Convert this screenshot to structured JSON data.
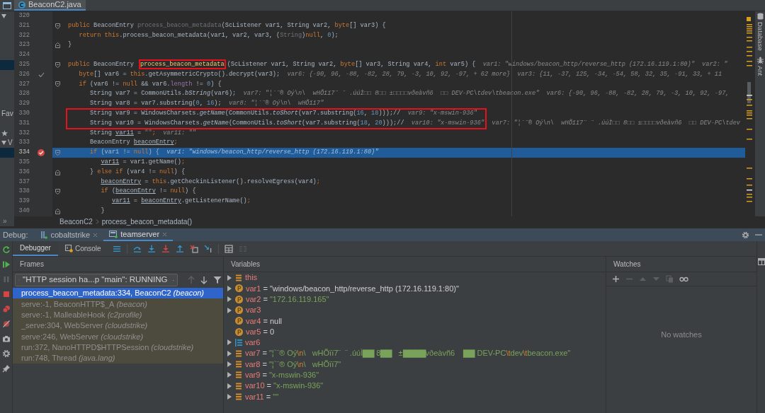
{
  "editor_tabs": [
    {
      "label": "BeaconC2.java",
      "selected": true
    }
  ],
  "project_panel": {
    "rows": [
      {
        "kind": "arrow",
        "selected": false
      },
      {
        "kind": "blank",
        "selected": false
      },
      {
        "kind": "blank",
        "selected": false
      },
      {
        "kind": "blank",
        "selected": false
      },
      {
        "kind": "blank",
        "selected": false
      },
      {
        "kind": "blank",
        "selected": true
      },
      {
        "kind": "blank",
        "selected": false
      },
      {
        "kind": "blank",
        "selected": false
      },
      {
        "kind": "blank",
        "selected": false
      },
      {
        "kind": "blank",
        "selected": false
      },
      {
        "kind": "label",
        "text": "Fav",
        "selected": false
      },
      {
        "kind": "blank",
        "selected": false
      },
      {
        "kind": "star",
        "selected": false
      },
      {
        "kind": "arrow-label",
        "text": "V",
        "selected": false
      },
      {
        "kind": "blank",
        "selected": true
      },
      {
        "kind": "blank",
        "selected": false
      },
      {
        "kind": "blank",
        "selected": false
      },
      {
        "kind": "blank",
        "selected": false
      },
      {
        "kind": "blank",
        "selected": false
      },
      {
        "kind": "blank",
        "selected": false
      },
      {
        "kind": "blank",
        "selected": false
      }
    ],
    "collapse_label": "»"
  },
  "editor": {
    "lines": [
      {
        "number": "320",
        "current": false,
        "breakpoint": false,
        "checked": false,
        "fold_start": false,
        "fold_end": false
      },
      {
        "number": "321",
        "current": false,
        "breakpoint": false,
        "checked": false,
        "fold_start": true,
        "fold_end": false,
        "code": [
          {
            "kind": "keyword",
            "text": "public"
          },
          {
            "kind": "plain",
            "text": " BeaconEntry "
          },
          {
            "kind": "unused",
            "text": "process_beacon_metadata"
          },
          {
            "kind": "plain",
            "text": "(ScListener var1, String var2, "
          },
          {
            "kind": "keyword",
            "text": "byte"
          },
          {
            "kind": "plain",
            "text": "[] var3) {"
          }
        ]
      },
      {
        "number": "322",
        "current": false,
        "breakpoint": false,
        "checked": false,
        "fold_start": false,
        "fold_end": false,
        "code": [
          {
            "kind": "keyword",
            "text": "   return this"
          },
          {
            "kind": "plain",
            "text": ".process_beacon_metadata(var1, var2, var3, ("
          },
          {
            "kind": "unused",
            "text": "String"
          },
          {
            "kind": "plain",
            "text": ")"
          },
          {
            "kind": "keyword",
            "text": "null"
          },
          {
            "kind": "plain",
            "text": ", "
          },
          {
            "kind": "number",
            "text": "0"
          },
          {
            "kind": "plain",
            "text": ");"
          }
        ]
      },
      {
        "number": "323",
        "current": false,
        "breakpoint": false,
        "checked": false,
        "fold_start": false,
        "fold_end": true,
        "code": [
          {
            "kind": "plain",
            "text": "}"
          }
        ]
      },
      {
        "number": "324",
        "current": false,
        "breakpoint": false,
        "checked": false,
        "fold_start": false,
        "fold_end": false
      },
      {
        "number": "325",
        "current": false,
        "breakpoint": false,
        "checked": false,
        "fold_start": true,
        "fold_end": false,
        "code": [
          {
            "kind": "keyword",
            "text": "public"
          },
          {
            "kind": "plain",
            "text": " BeaconEntry "
          },
          {
            "kind": "declaration",
            "text": "process_beacon_metadata",
            "boxed": true
          },
          {
            "kind": "plain",
            "text": "(ScListener var1, String var2, "
          },
          {
            "kind": "keyword",
            "text": "byte"
          },
          {
            "kind": "plain",
            "text": "[] var3, String var4, "
          },
          {
            "kind": "keyword",
            "text": "int"
          },
          {
            "kind": "plain",
            "text": " var5) {"
          },
          {
            "kind": "hint",
            "text": "  var1: \"windows/beacon_http/reverse_http (172.16.119.1:80)\"  var2: \""
          }
        ]
      },
      {
        "number": "326",
        "current": false,
        "breakpoint": false,
        "checked": true,
        "fold_start": false,
        "fold_end": false,
        "code": [
          {
            "kind": "keyword",
            "text": "   byte"
          },
          {
            "kind": "plain",
            "text": "[] var6 = "
          },
          {
            "kind": "keyword",
            "text": "this"
          },
          {
            "kind": "plain",
            "text": ".getAsymmetricCrypto().decrypt(var3);"
          },
          {
            "kind": "hint",
            "text": "  var6: {-90, 96, -88, -82, 28, 79, -3, 10, 92, -97, + 62 more}  var3: {11, -37, 125, -34, -54, 58, 32, 35, -91, 33, + 11"
          }
        ]
      },
      {
        "number": "327",
        "current": false,
        "breakpoint": false,
        "checked": false,
        "fold_start": true,
        "fold_end": false,
        "code": [
          {
            "kind": "keyword",
            "text": "   if"
          },
          {
            "kind": "plain",
            "text": " (var6 != "
          },
          {
            "kind": "keyword",
            "text": "null"
          },
          {
            "kind": "plain",
            "text": " && var6."
          },
          {
            "kind": "field",
            "text": "length"
          },
          {
            "kind": "plain",
            "text": " != "
          },
          {
            "kind": "number",
            "text": "0"
          },
          {
            "kind": "plain",
            "text": ") {"
          }
        ]
      },
      {
        "number": "328",
        "current": false,
        "breakpoint": false,
        "checked": false,
        "fold_start": false,
        "fold_end": false,
        "code": [
          {
            "kind": "plain",
            "text": "      String var7 = CommonUtils."
          },
          {
            "kind": "static_call",
            "text": "bString"
          },
          {
            "kind": "plain",
            "text": "(var6);"
          },
          {
            "kind": "hint",
            "text": "  var7: \"¦`¨® Oý\\n\\  wHÕïï7¨ ¨ .úúÌ□□ 8□□ ±□□□□vðeàvñ6  □□ DEV-PC\\tdev\\tbeacon.exe\"  var6: {-90, 96, -88, -82, 28, 79, -3, 10, 92, -97,"
          }
        ]
      },
      {
        "number": "329",
        "current": false,
        "breakpoint": false,
        "checked": false,
        "fold_start": false,
        "fold_end": false,
        "code": [
          {
            "kind": "plain",
            "text": "      String var8 = var7.substring("
          },
          {
            "kind": "number",
            "text": "0"
          },
          {
            "kind": "plain",
            "text": ", "
          },
          {
            "kind": "number",
            "text": "16"
          },
          {
            "kind": "plain",
            "text": ");"
          },
          {
            "kind": "hint",
            "text": "  var8: \"¦`¨® Oý\\n\\  wHÕïï7\""
          }
        ]
      },
      {
        "number": "330",
        "current": false,
        "breakpoint": false,
        "checked": false,
        "fold_start": false,
        "fold_end": false,
        "code": [
          {
            "kind": "plain",
            "text": "      String var9 = WindowsCharsets.",
            "boxed": true
          },
          {
            "kind": "static_call",
            "text": "getName",
            "boxed": true
          },
          {
            "kind": "plain",
            "text": "(CommonUtils.",
            "boxed": true
          },
          {
            "kind": "static_call",
            "text": "toShort",
            "boxed": true
          },
          {
            "kind": "plain",
            "text": "(var7.substring(",
            "boxed": true
          },
          {
            "kind": "number",
            "text": "16",
            "boxed": true
          },
          {
            "kind": "plain",
            "text": ", ",
            "boxed": true
          },
          {
            "kind": "number",
            "text": "18",
            "boxed": true
          },
          {
            "kind": "plain",
            "text": ")));//",
            "boxed": true
          },
          {
            "kind": "hint",
            "text": "  var9: \"x-mswin-936\"",
            "boxed": true
          }
        ]
      },
      {
        "number": "331",
        "current": false,
        "breakpoint": false,
        "checked": false,
        "fold_start": false,
        "fold_end": false,
        "code": [
          {
            "kind": "plain",
            "text": "      String var10 = WindowsCharsets.",
            "boxed": true
          },
          {
            "kind": "static_call",
            "text": "getName",
            "boxed": true
          },
          {
            "kind": "plain",
            "text": "(CommonUtils.",
            "boxed": true
          },
          {
            "kind": "static_call",
            "text": "toShort",
            "boxed": true
          },
          {
            "kind": "plain",
            "text": "(var7.substring(",
            "boxed": true
          },
          {
            "kind": "number",
            "text": "18",
            "boxed": true
          },
          {
            "kind": "plain",
            "text": ", ",
            "boxed": true
          },
          {
            "kind": "number",
            "text": "20",
            "boxed": true
          },
          {
            "kind": "plain",
            "text": ")));//",
            "boxed": true
          },
          {
            "kind": "hint",
            "text": "  var10: \"x-mswin-936\"",
            "boxed": true
          },
          {
            "kind": "hint",
            "text": "  var7: \"¦`¨® Oý\\n\\  wHÕïï7¨ ¨ .úúÌ□□ 8□□ ±□□□□vðeàvñ6  □□ DEV-PC\\tdev"
          }
        ]
      },
      {
        "number": "332",
        "current": false,
        "breakpoint": false,
        "checked": false,
        "fold_start": false,
        "fold_end": false,
        "code": [
          {
            "kind": "plain",
            "text": "      String "
          },
          {
            "kind": "local",
            "text": "var11"
          },
          {
            "kind": "plain",
            "text": " = "
          },
          {
            "kind": "string",
            "text": "\"\""
          },
          {
            "kind": "keyword",
            "text": ";"
          },
          {
            "kind": "hint",
            "text": "  var11: \"\""
          }
        ]
      },
      {
        "number": "333",
        "current": false,
        "breakpoint": false,
        "checked": false,
        "fold_start": false,
        "fold_end": false,
        "code": [
          {
            "kind": "plain",
            "text": "      BeaconEntry "
          },
          {
            "kind": "local",
            "text": "beaconEntry"
          },
          {
            "kind": "keyword",
            "text": ";"
          }
        ]
      },
      {
        "number": "334",
        "current": true,
        "breakpoint": true,
        "checked": false,
        "fold_start": true,
        "fold_end": false,
        "code": [
          {
            "kind": "keyword",
            "text": "      if"
          },
          {
            "kind": "plain",
            "text": " (var1 != "
          },
          {
            "kind": "keyword",
            "text": "null"
          },
          {
            "kind": "plain",
            "text": ") {"
          },
          {
            "kind": "hint",
            "text": "  var1: \"windows/beacon_http/reverse_http (172.16.119.1:80)\""
          }
        ]
      },
      {
        "number": "335",
        "current": false,
        "breakpoint": false,
        "checked": false,
        "fold_start": false,
        "fold_end": false,
        "code": [
          {
            "kind": "local",
            "text": "         var11"
          },
          {
            "kind": "plain",
            "text": " = var1.getName()"
          },
          {
            "kind": "keyword",
            "text": ";"
          }
        ]
      },
      {
        "number": "336",
        "current": false,
        "breakpoint": false,
        "checked": false,
        "fold_start": false,
        "fold_end": true,
        "code": [
          {
            "kind": "plain",
            "text": "      } "
          },
          {
            "kind": "keyword",
            "text": "else if"
          },
          {
            "kind": "plain",
            "text": " (var4 != "
          },
          {
            "kind": "keyword",
            "text": "null"
          },
          {
            "kind": "plain",
            "text": ") {"
          }
        ]
      },
      {
        "number": "337",
        "current": false,
        "breakpoint": false,
        "checked": false,
        "fold_start": false,
        "fold_end": false,
        "code": [
          {
            "kind": "local",
            "text": "         beaconEntry"
          },
          {
            "kind": "plain",
            "text": " = "
          },
          {
            "kind": "keyword",
            "text": "this"
          },
          {
            "kind": "plain",
            "text": ".getCheckinListener().resolveEgress(var4)"
          },
          {
            "kind": "keyword",
            "text": ";"
          }
        ]
      },
      {
        "number": "338",
        "current": false,
        "breakpoint": false,
        "checked": false,
        "fold_start": true,
        "fold_end": false,
        "code": [
          {
            "kind": "keyword",
            "text": "         if"
          },
          {
            "kind": "plain",
            "text": " ("
          },
          {
            "kind": "local",
            "text": "beaconEntry"
          },
          {
            "kind": "plain",
            "text": " != "
          },
          {
            "kind": "keyword",
            "text": "null"
          },
          {
            "kind": "plain",
            "text": ") {"
          }
        ]
      },
      {
        "number": "339",
        "current": false,
        "breakpoint": false,
        "checked": false,
        "fold_start": false,
        "fold_end": false,
        "code": [
          {
            "kind": "local",
            "text": "            var11"
          },
          {
            "kind": "plain",
            "text": " = "
          },
          {
            "kind": "local",
            "text": "beaconEntry"
          },
          {
            "kind": "plain",
            "text": ".getListenerName()"
          },
          {
            "kind": "keyword",
            "text": ";"
          }
        ]
      },
      {
        "number": "340",
        "current": false,
        "breakpoint": false,
        "checked": false,
        "fold_start": false,
        "fold_end": true,
        "code": [
          {
            "kind": "plain",
            "text": "         }"
          }
        ]
      }
    ]
  },
  "side_tools": [
    {
      "kind": "database",
      "label": "Database"
    },
    {
      "kind": "ant",
      "label": "Ant"
    }
  ],
  "breadcrumb": [
    "BeaconC2",
    "process_beacon_metadata()"
  ],
  "debug": {
    "label": "Debug:",
    "sessions": [
      {
        "label": "cobaltstrike",
        "selected": false
      },
      {
        "label": "teamserver",
        "selected": true
      }
    ],
    "tabs": [
      {
        "label": "Debugger",
        "selected": true
      },
      {
        "label": "Console",
        "selected": false
      }
    ],
    "frames": {
      "title": "Frames",
      "thread": "\"HTTP session ha...p \"main\": RUNNING",
      "items": [
        {
          "location": "process_beacon_metadata:334, BeaconC2",
          "package": "(beacon)",
          "library": false,
          "selected": true
        },
        {
          "location": "serve:-1, BeaconHTTP$_A",
          "package": "(beacon)",
          "library": true,
          "selected": false
        },
        {
          "location": "serve:-1, MalleableHook",
          "package": "(c2profile)",
          "library": true,
          "selected": false
        },
        {
          "location": "_serve:304, WebServer",
          "package": "(cloudstrike)",
          "library": true,
          "selected": false
        },
        {
          "location": "serve:246, WebServer",
          "package": "(cloudstrike)",
          "library": true,
          "selected": false
        },
        {
          "location": "run:372, NanoHTTPD$HTTPSession",
          "package": "(cloudstrike)",
          "library": true,
          "selected": false
        },
        {
          "location": "run:748, Thread",
          "package": "(java.lang)",
          "library": true,
          "selected": false
        }
      ]
    },
    "variables": {
      "title": "Variables",
      "items": [
        {
          "kind": "field",
          "expandable": true,
          "name": "this"
        },
        {
          "kind": "parameter",
          "expandable": true,
          "name": "var1",
          "value": [
            {
              "kind": "plain",
              "text": " = \"windows/beacon_http/reverse_http (172.16.119.1:80)\""
            }
          ]
        },
        {
          "kind": "parameter",
          "expandable": true,
          "name": "var2",
          "value": [
            {
              "kind": "plain",
              "text": " = "
            },
            {
              "kind": "string",
              "text": "\"172.16.119.165\""
            }
          ]
        },
        {
          "kind": "parameter",
          "expandable": true,
          "name": "var3"
        },
        {
          "kind": "parameter",
          "expandable": false,
          "name": "var4",
          "value": [
            {
              "kind": "plain",
              "text": " = null"
            }
          ]
        },
        {
          "kind": "parameter",
          "expandable": false,
          "name": "var5",
          "value": [
            {
              "kind": "plain",
              "text": " = 0"
            }
          ]
        },
        {
          "kind": "array",
          "expandable": true,
          "name": "var6"
        },
        {
          "kind": "field",
          "expandable": true,
          "name": "var7",
          "value": [
            {
              "kind": "plain",
              "text": " = "
            },
            {
              "kind": "string",
              "text": "\"¦`¨® Oý"
            },
            {
              "kind": "escape",
              "text": "\\n"
            },
            {
              "kind": "string",
              "text": "\\   wHÕïï7¨  ¨ .úúÌ▇▇ 8▇▇   ±▇▇▇▇vðeàvñ6    ▇▇ DEV-PC"
            },
            {
              "kind": "escape",
              "text": "\\t"
            },
            {
              "kind": "string",
              "text": "dev"
            },
            {
              "kind": "escape",
              "text": "\\t"
            },
            {
              "kind": "string",
              "text": "beacon.exe\""
            }
          ]
        },
        {
          "kind": "field",
          "expandable": true,
          "name": "var8",
          "value": [
            {
              "kind": "plain",
              "text": " = "
            },
            {
              "kind": "string",
              "text": "\"¦`¨® Oý"
            },
            {
              "kind": "escape",
              "text": "\\n"
            },
            {
              "kind": "string",
              "text": "\\   wHÕïï7\""
            }
          ]
        },
        {
          "kind": "field",
          "expandable": true,
          "name": "var9",
          "value": [
            {
              "kind": "plain",
              "text": " = "
            },
            {
              "kind": "string",
              "text": "\"x-mswin-936\""
            }
          ]
        },
        {
          "kind": "field",
          "expandable": true,
          "name": "var10",
          "value": [
            {
              "kind": "plain",
              "text": " = "
            },
            {
              "kind": "string",
              "text": "\"x-mswin-936\""
            }
          ]
        },
        {
          "kind": "field",
          "expandable": true,
          "name": "var11",
          "value": [
            {
              "kind": "plain",
              "text": " = "
            },
            {
              "kind": "string",
              "text": "\"\""
            }
          ]
        }
      ]
    },
    "watches": {
      "title": "Watches",
      "empty_text": "No watches"
    }
  }
}
